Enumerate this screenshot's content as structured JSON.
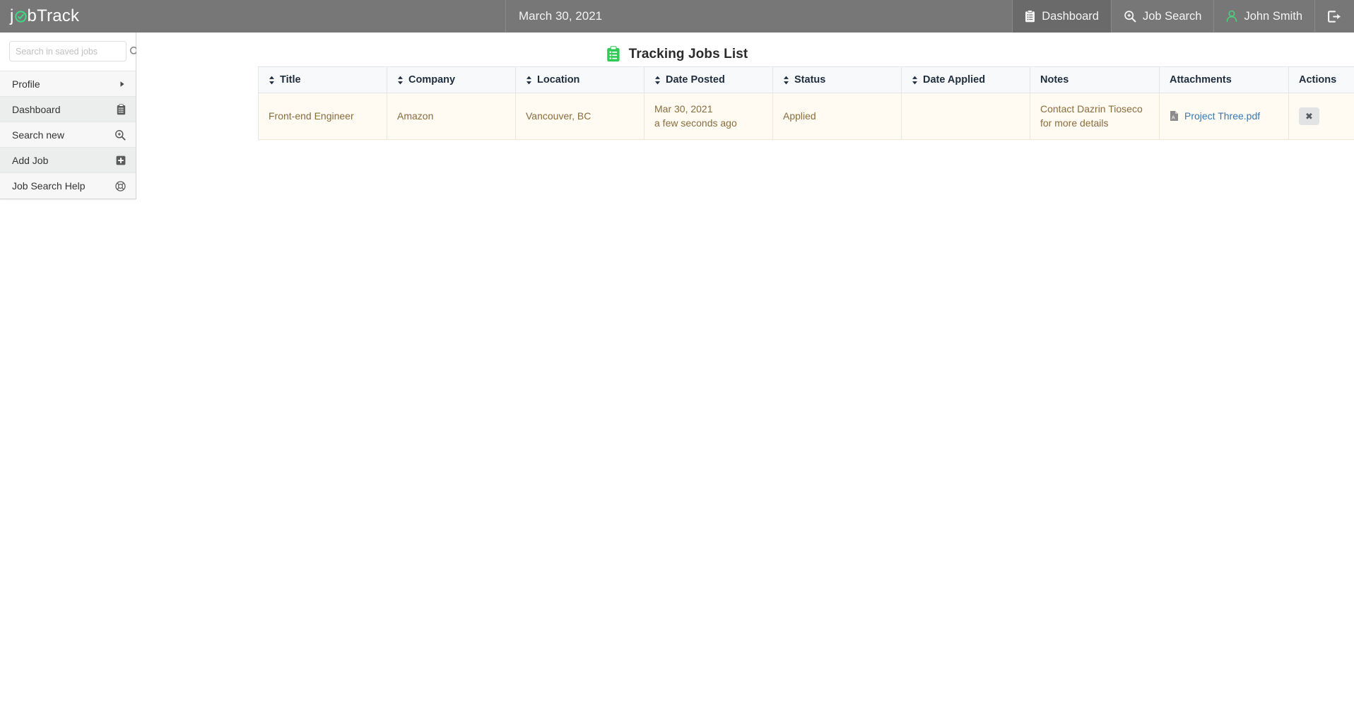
{
  "topbar": {
    "brand": {
      "prefix": "j",
      "icon": "check-circle-icon",
      "suffix": "bTrack"
    },
    "date": "March 30, 2021",
    "nav": [
      {
        "label": "Dashboard",
        "icon": "clipboard-icon",
        "active": true
      },
      {
        "label": "Job Search",
        "icon": "search-plus-icon",
        "active": false
      },
      {
        "label": "John Smith",
        "icon": "user-icon",
        "active": false
      }
    ],
    "logout_icon": "sign-out-icon",
    "colors": {
      "bar": "#777777",
      "active": "#6a6a6a",
      "user_icon": "#4cd07d"
    }
  },
  "sidebar": {
    "search": {
      "placeholder": "Search in saved jobs",
      "value": "",
      "icon": "search-icon"
    },
    "items": [
      {
        "label": "Profile",
        "icon": "caret-right-icon"
      },
      {
        "label": "Dashboard",
        "icon": "clipboard-icon"
      },
      {
        "label": "Search new",
        "icon": "search-plus-icon"
      },
      {
        "label": "Add Job",
        "icon": "plus-square-icon"
      },
      {
        "label": "Job Search Help",
        "icon": "life-ring-icon"
      }
    ]
  },
  "main": {
    "title": "Tracking Jobs List",
    "title_icon": "clipboard-list-icon",
    "title_icon_color": "#2ecc55"
  },
  "table": {
    "columns": [
      {
        "label": "Title",
        "sortable": true
      },
      {
        "label": "Company",
        "sortable": true
      },
      {
        "label": "Location",
        "sortable": true
      },
      {
        "label": "Date Posted",
        "sortable": true
      },
      {
        "label": "Status",
        "sortable": true
      },
      {
        "label": "Date Applied",
        "sortable": true
      },
      {
        "label": "Notes",
        "sortable": false
      },
      {
        "label": "Attachments",
        "sortable": false
      },
      {
        "label": "Actions",
        "sortable": false
      }
    ],
    "rows": [
      {
        "title": "Front-end Engineer",
        "company": "Amazon",
        "location": "Vancouver, BC",
        "date_posted": "Mar 30, 2021",
        "date_posted_relative": "a few seconds ago",
        "status": "Applied",
        "date_applied": "",
        "notes": "Contact Dazrin Tioseco for more details",
        "attachment": "Project Three.pdf",
        "attachment_icon": "file-pdf-icon",
        "action_label": "✖",
        "action_name": "delete-job-button"
      }
    ]
  }
}
